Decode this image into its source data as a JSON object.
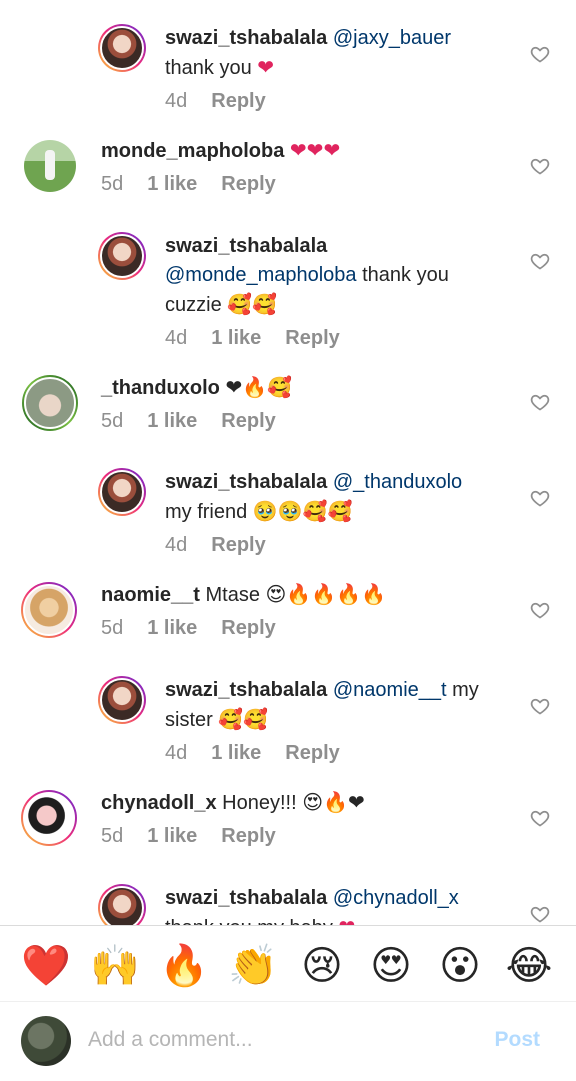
{
  "comments": [
    {
      "user": "swazi_tshabalala",
      "mention": "@jaxy_bauer",
      "text": "",
      "line2": "thank you",
      "line2_emoji": "❤",
      "time": "4d",
      "likes": "",
      "reply": "Reply",
      "avatar": "av1"
    },
    {
      "user": "monde_mapholoba",
      "text": "",
      "emoji": "❤❤❤",
      "time": "5d",
      "likes": "1 like",
      "reply": "Reply",
      "avatar": "av2"
    },
    {
      "user": "swazi_tshabalala",
      "line2_mention": "@monde_mapholoba",
      "line2": " thank you",
      "line3": "cuzzie",
      "line3_emoji": "🥰🥰",
      "time": "4d",
      "likes": "1 like",
      "reply": "Reply",
      "avatar": "av1"
    },
    {
      "user": "_thanduxolo",
      "emoji": "❤🔥🥰",
      "time": "5d",
      "likes": "1 like",
      "reply": "Reply",
      "avatar": "av3"
    },
    {
      "user": "swazi_tshabalala",
      "mention": "@_thanduxolo",
      "line2": "my friend",
      "line2_emoji": "🥹🥹🥰🥰",
      "time": "4d",
      "likes": "",
      "reply": "Reply",
      "avatar": "av1"
    },
    {
      "user": "naomie__t",
      "text": "Mtase",
      "emoji": "😍🔥🔥🔥🔥",
      "time": "5d",
      "likes": "1 like",
      "reply": "Reply",
      "avatar": "av4"
    },
    {
      "user": "swazi_tshabalala",
      "mention": "@naomie__t",
      "text": " my",
      "line2": "sister",
      "line2_emoji": "🥰🥰",
      "time": "4d",
      "likes": "1 like",
      "reply": "Reply",
      "avatar": "av1"
    },
    {
      "user": "chynadoll_x",
      "text": "Honey!!!",
      "emoji": "😍🔥❤",
      "time": "5d",
      "likes": "1 like",
      "reply": "Reply",
      "avatar": "av5"
    },
    {
      "user": "swazi_tshabalala",
      "mention": "@chynadoll_x",
      "line2": "thank you my baby",
      "line2_emoji": "❤",
      "avatar": "av1"
    }
  ],
  "reaction_tray": [
    "❤️",
    "🙌",
    "🔥",
    "👏",
    "😢",
    "😍",
    "😮",
    "😂"
  ],
  "composer": {
    "placeholder": "Add a comment...",
    "post_label": "Post"
  },
  "icons": {
    "like": "heart-outline-icon"
  },
  "colors": {
    "mention": "#00376b",
    "meta": "#8e8e8e",
    "post": "#b3dbff"
  }
}
